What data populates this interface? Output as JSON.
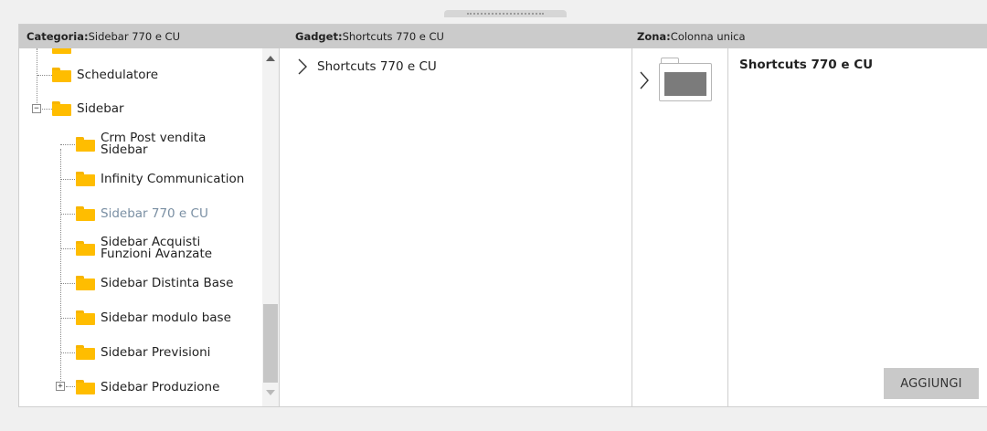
{
  "header": {
    "category_key": "Categoria:",
    "category_value": "Sidebar 770 e CU",
    "gadget_key": "Gadget:",
    "gadget_value": "Shortcuts 770 e CU",
    "zone_key": "Zona:",
    "zone_value": "Colonna unica"
  },
  "tree": {
    "items": [
      {
        "label": "Schedulatore"
      },
      {
        "label": "Sidebar"
      },
      {
        "label": "Crm Post vendita\nSidebar"
      },
      {
        "label": "Infinity Communication"
      },
      {
        "label": "Sidebar 770 e CU"
      },
      {
        "label": "Sidebar Acquisti\nFunzioni Avanzate"
      },
      {
        "label": "Sidebar Distinta Base"
      },
      {
        "label": "Sidebar modulo base"
      },
      {
        "label": "Sidebar Previsioni"
      },
      {
        "label": "Sidebar Produzione"
      }
    ],
    "expanders": {
      "sidebar": "−",
      "produzione": "+"
    },
    "selected_label": "Sidebar 770 e CU"
  },
  "gadgets": {
    "items": [
      {
        "label": "Shortcuts 770 e CU"
      }
    ]
  },
  "preview": {
    "title": "Shortcuts 770 e CU"
  },
  "actions": {
    "add_label": "AGGIUNGI"
  },
  "colors": {
    "folder": "#ffbd00",
    "selected_text": "#7a8fa3",
    "header_bg": "#cbcbcb",
    "button_bg": "#c9c9c9"
  },
  "icons": [
    "folder-icon",
    "chevron-right-icon",
    "expand-icon",
    "collapse-icon",
    "scroll-up-icon",
    "scroll-down-icon",
    "gadget-preview-icon"
  ]
}
